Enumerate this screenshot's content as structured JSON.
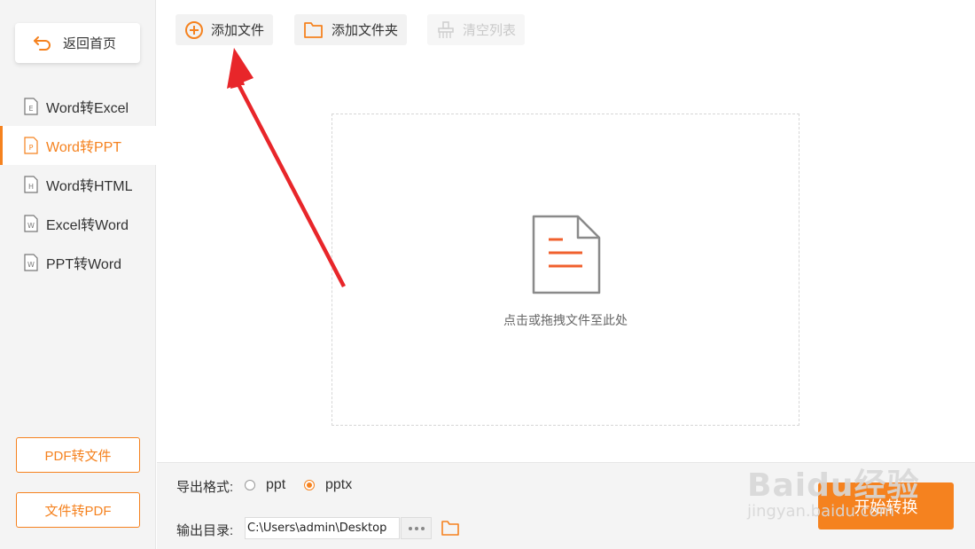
{
  "sidebar": {
    "back_label": "返回首页",
    "items": [
      {
        "label": "Word转Excel",
        "icon": "E"
      },
      {
        "label": "Word转PPT",
        "icon": "P"
      },
      {
        "label": "Word转HTML",
        "icon": "H"
      },
      {
        "label": "Excel转Word",
        "icon": "W"
      },
      {
        "label": "PPT转Word",
        "icon": "W"
      }
    ],
    "active_index": 1,
    "pdf_to_file": "PDF转文件",
    "file_to_pdf": "文件转PDF"
  },
  "toolbar": {
    "add_file": "添加文件",
    "add_folder": "添加文件夹",
    "clear_list": "清空列表"
  },
  "dropzone": {
    "hint": "点击或拖拽文件至此处"
  },
  "bottom": {
    "format_label": "导出格式:",
    "options": [
      "ppt",
      "pptx"
    ],
    "selected": "pptx",
    "output_label": "输出目录:",
    "output_path": "C:\\Users\\admin\\Desktop",
    "start_label": "开始转换"
  },
  "watermark": {
    "logo": "Baidu经验",
    "sub": "jingyan.baidu.com"
  },
  "colors": {
    "accent": "#f5821f",
    "arrow": "#e8262a"
  }
}
